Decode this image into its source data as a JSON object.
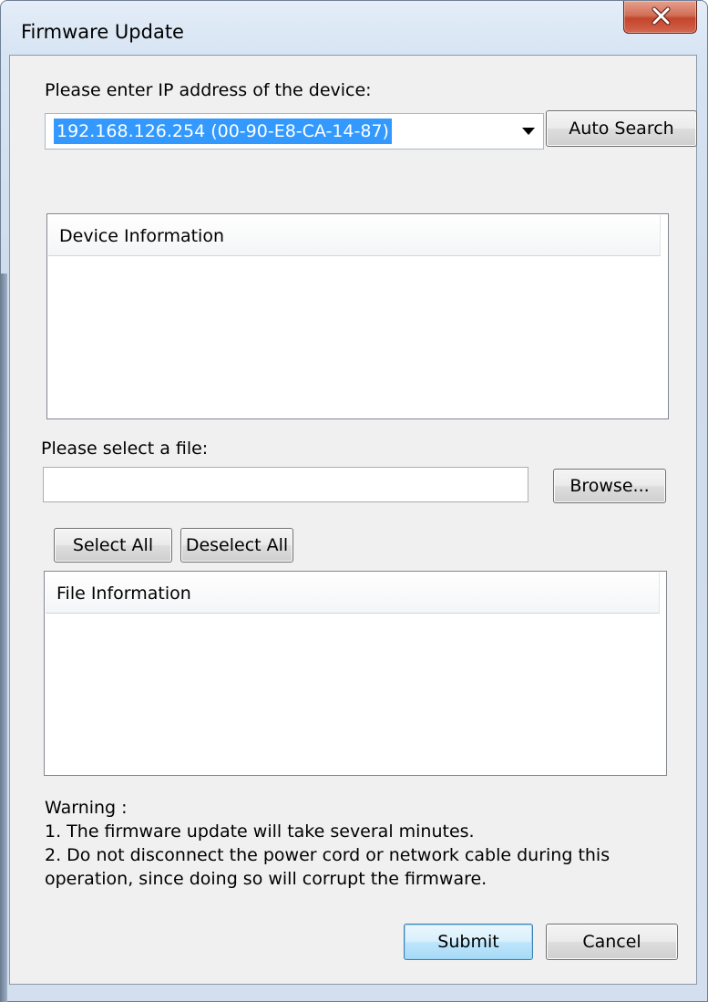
{
  "window": {
    "title": "Firmware Update",
    "close_icon": "close-icon"
  },
  "ip_section": {
    "label": "Please enter IP address of the device:",
    "selected_value": "192.168.126.254 (00-90-E8-CA-14-87)",
    "auto_search_label": "Auto Search"
  },
  "device_info": {
    "header": "Device Information"
  },
  "file_section": {
    "label": "Please select a file:",
    "file_path": "",
    "browse_label": "Browse...",
    "select_all_label": "Select All",
    "deselect_all_label": "Deselect All"
  },
  "file_info": {
    "header": "File Information"
  },
  "warning": {
    "title": "Warning :",
    "line1": "1. The firmware update will take several minutes.",
    "line2": "2. Do not disconnect the power cord or network cable during this",
    "line3": "operation, since doing so will corrupt the firmware."
  },
  "footer": {
    "submit_label": "Submit",
    "cancel_label": "Cancel"
  },
  "colors": {
    "selection": "#3399ff",
    "close_button": "#c2452c",
    "default_button_border": "#3c7fb1"
  }
}
